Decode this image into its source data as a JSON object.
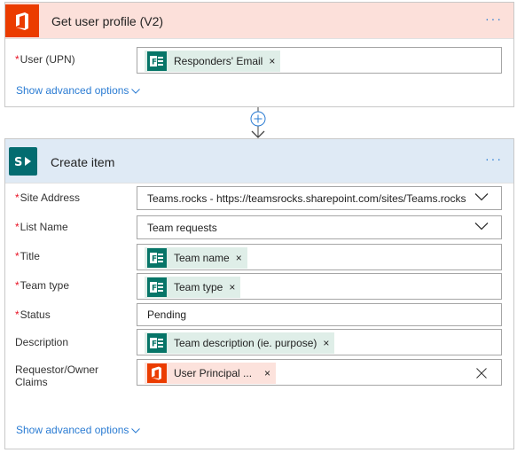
{
  "card1": {
    "title": "Get user profile (V2)",
    "more": "···",
    "fields": [
      {
        "label": "User (UPN)",
        "required_mark": "*",
        "token": "Responders' Email",
        "token_x": "×"
      }
    ],
    "advanced": "Show advanced options"
  },
  "card2": {
    "title": "Create item",
    "more": "···",
    "site_address": {
      "label": "Site Address",
      "required_mark": "*",
      "value": "Teams.rocks - https://teamsrocks.sharepoint.com/sites/Teams.rocks"
    },
    "list_name": {
      "label": "List Name",
      "required_mark": "*",
      "value": "Team requests"
    },
    "title_field": {
      "label": "Title",
      "required_mark": "*",
      "token": "Team name",
      "token_x": "×"
    },
    "team_type": {
      "label": "Team type",
      "required_mark": "*",
      "token": "Team type",
      "token_x": "×"
    },
    "status": {
      "label": "Status",
      "required_mark": "*",
      "value": "Pending"
    },
    "description": {
      "label": "Description",
      "token": "Team description (ie. purpose)",
      "token_x": "×"
    },
    "requestor": {
      "label_line1": "Requestor/Owner",
      "label_line2": "Claims",
      "token": "User Principal ...",
      "token_x": "×"
    },
    "advanced": "Show advanced options"
  },
  "colors": {
    "office_orange": "#eb3c00",
    "sharepoint_teal": "#036c70",
    "forms_green": "#077568",
    "link_blue": "#2b7cd3",
    "required_red": "#e81123"
  },
  "icons": [
    "office-icon",
    "sharepoint-icon",
    "forms-icon",
    "chevron-down-icon",
    "add-step-icon",
    "close-icon"
  ]
}
